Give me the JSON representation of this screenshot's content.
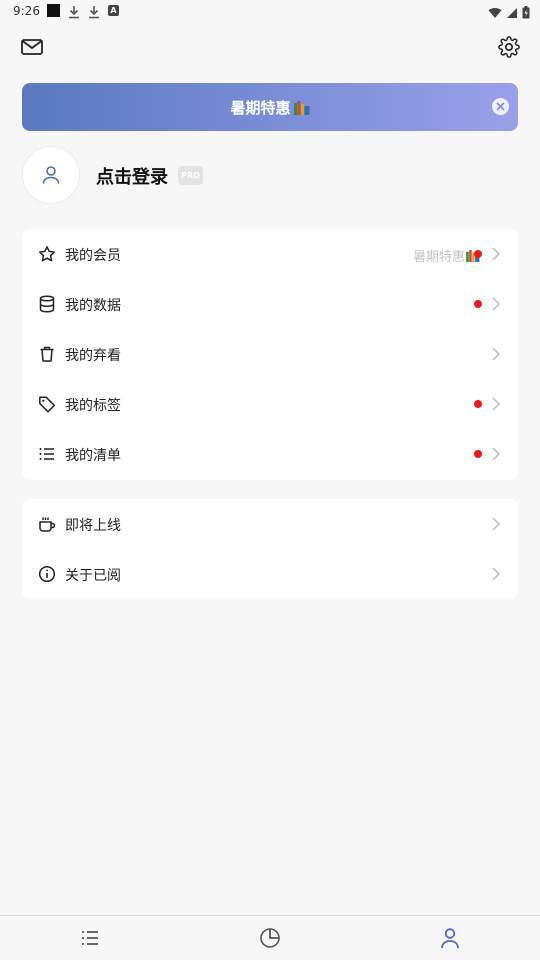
{
  "status_bar": {
    "time": "9:26"
  },
  "header": {
    "icons": [
      "mail-icon",
      "gear-icon"
    ]
  },
  "promo": {
    "text": "暑期特惠",
    "emoji": "books-emoji"
  },
  "profile": {
    "login_label": "点击登录",
    "badge": "PRO"
  },
  "menu_group_1": [
    {
      "label": "我的会员",
      "icon": "star-icon",
      "note": "暑期特惠",
      "dot": true
    },
    {
      "label": "我的数据",
      "icon": "database-icon",
      "note": "",
      "dot": true
    },
    {
      "label": "我的弃看",
      "icon": "trash-icon",
      "note": "",
      "dot": false
    },
    {
      "label": "我的标签",
      "icon": "tag-icon",
      "note": "",
      "dot": true
    },
    {
      "label": "我的清单",
      "icon": "list-icon",
      "note": "",
      "dot": true
    }
  ],
  "menu_group_2": [
    {
      "label": "即将上线",
      "icon": "coffee-icon"
    },
    {
      "label": "关于已阅",
      "icon": "info-icon"
    }
  ],
  "bottom_nav": {
    "items": [
      "list-icon",
      "pie-chart-icon",
      "user-icon"
    ],
    "active_index": 2
  },
  "colors": {
    "accent": "#4d6bb8",
    "dot": "#f01818",
    "banner_start": "#5a79c0",
    "banner_end": "#9aa0ea"
  }
}
